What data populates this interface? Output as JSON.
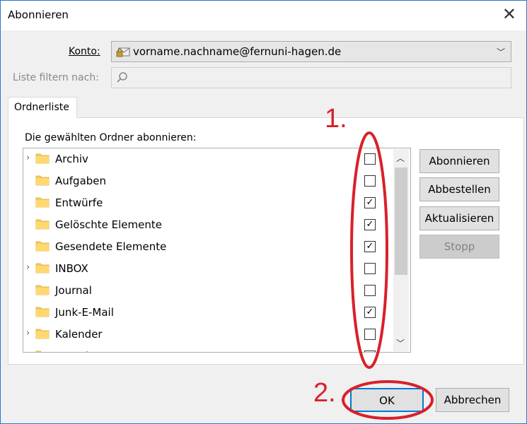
{
  "window": {
    "title": "Abonnieren"
  },
  "account": {
    "label": "Konto:",
    "value": "vorname.nachname@fernuni-hagen.de"
  },
  "filter": {
    "label": "Liste filtern nach:",
    "value": ""
  },
  "tab": {
    "label": "Ordnerliste"
  },
  "list": {
    "heading": "Die gewählten Ordner abonnieren:",
    "items": [
      {
        "name": "Archiv",
        "expandable": true,
        "checked": false
      },
      {
        "name": "Aufgaben",
        "expandable": false,
        "checked": false
      },
      {
        "name": "Entwürfe",
        "expandable": false,
        "checked": true
      },
      {
        "name": "Gelöschte Elemente",
        "expandable": false,
        "checked": true
      },
      {
        "name": "Gesendete Elemente",
        "expandable": false,
        "checked": true
      },
      {
        "name": "INBOX",
        "expandable": true,
        "checked": false
      },
      {
        "name": "Journal",
        "expandable": false,
        "checked": false
      },
      {
        "name": "Junk-E-Mail",
        "expandable": false,
        "checked": true
      },
      {
        "name": "Kalender",
        "expandable": true,
        "checked": false
      },
      {
        "name": "Kontakte",
        "expandable": true,
        "checked": false
      }
    ]
  },
  "side_buttons": {
    "subscribe": "Abonnieren",
    "unsubscribe": "Abbestellen",
    "refresh": "Aktualisieren",
    "stop": "Stopp"
  },
  "footer": {
    "ok": "OK",
    "cancel": "Abbrechen"
  },
  "annotations": {
    "step1": "1.",
    "step2": "2.",
    "color": "#d9202a"
  },
  "icons": {
    "close": "close-icon",
    "folder": "folder-icon",
    "chevron": "chevron-down-icon",
    "search": "search-icon",
    "account": "account-icon"
  }
}
